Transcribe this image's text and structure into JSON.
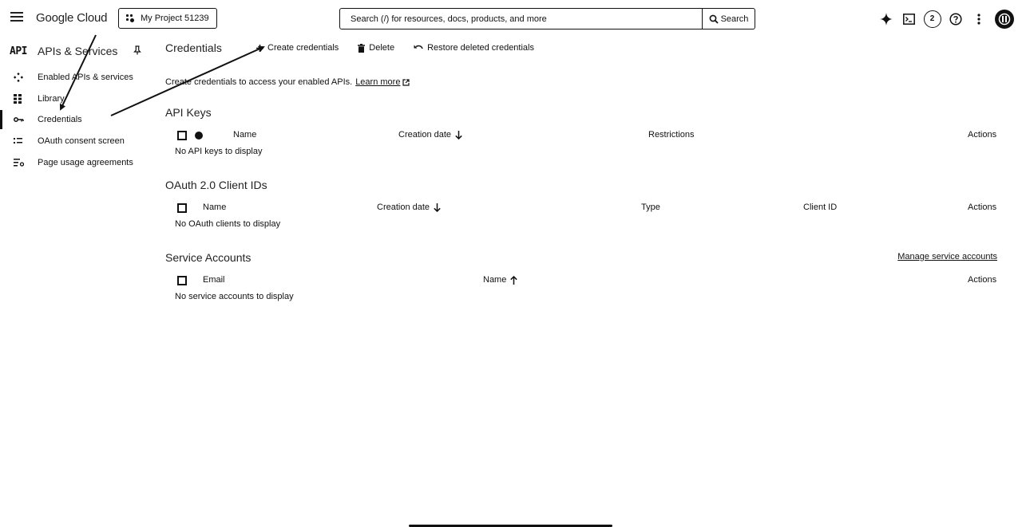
{
  "topbar": {
    "brand": "Google Cloud",
    "project": "My Project 51239",
    "search_placeholder": "Search (/) for resources, docs, products, and more",
    "search_button": "Search",
    "notifications_count": "2"
  },
  "sidebar": {
    "logo": "API",
    "title": "APIs & Services",
    "items": [
      {
        "label": "Enabled APIs & services",
        "icon": "diamond-icon"
      },
      {
        "label": "Library",
        "icon": "library-icon"
      },
      {
        "label": "Credentials",
        "icon": "key-icon",
        "active": true
      },
      {
        "label": "OAuth consent screen",
        "icon": "consent-icon"
      },
      {
        "label": "Page usage agreements",
        "icon": "settings-list-icon"
      }
    ]
  },
  "main": {
    "title": "Credentials",
    "toolbar": {
      "create": "Create credentials",
      "delete": "Delete",
      "restore": "Restore deleted credentials"
    },
    "intro_text": "Create credentials to access your enabled APIs.",
    "learn_more": "Learn more",
    "api_keys": {
      "title": "API Keys",
      "columns": [
        "Name",
        "Creation date",
        "Restrictions",
        "Actions"
      ],
      "empty": "No API keys to display"
    },
    "oauth": {
      "title": "OAuth 2.0 Client IDs",
      "columns": [
        "Name",
        "Creation date",
        "Type",
        "Client ID",
        "Actions"
      ],
      "empty": "No OAuth clients to display"
    },
    "service_accounts": {
      "title": "Service Accounts",
      "manage_link": "Manage service accounts",
      "columns": [
        "Email",
        "Name",
        "Actions"
      ],
      "empty": "No service accounts to display"
    }
  }
}
